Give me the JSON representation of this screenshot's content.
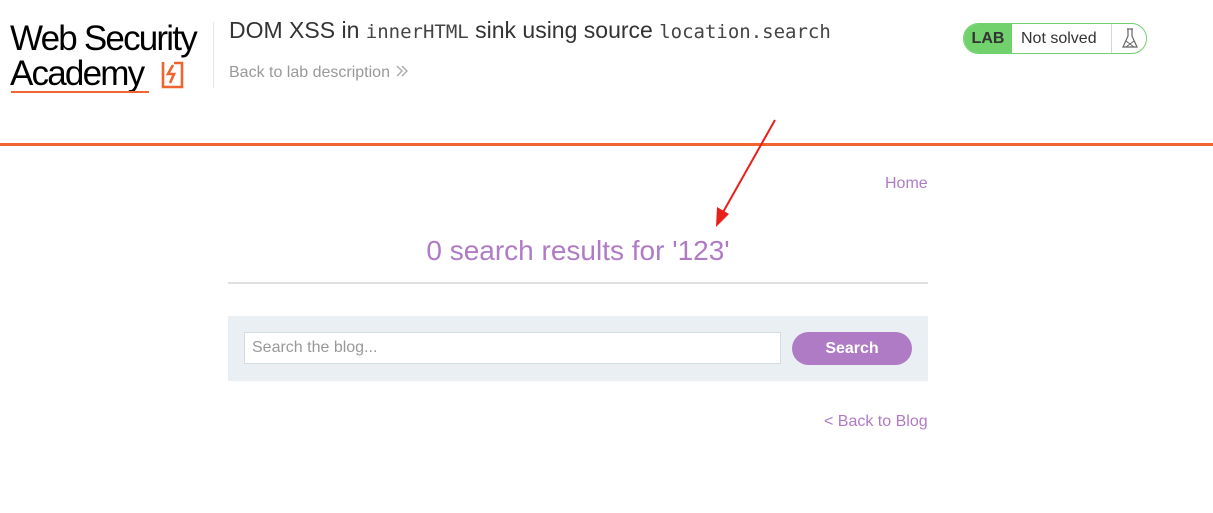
{
  "logo": {
    "line1": "Web Security",
    "line2": "Academy"
  },
  "header": {
    "title_prefix": "DOM XSS in ",
    "title_code1": "innerHTML",
    "title_middle": " sink using source ",
    "title_code2": "location.search",
    "back_link": "Back to lab description"
  },
  "status": {
    "lab_label": "LAB",
    "state": "Not solved"
  },
  "nav": {
    "home": "Home"
  },
  "results": {
    "heading": "0 search results for '123'"
  },
  "search": {
    "placeholder": "Search the blog...",
    "value": "",
    "button_label": "Search"
  },
  "footer": {
    "back_to_blog": "< Back to Blog"
  },
  "colors": {
    "brand_orange": "#f0652f",
    "accent_purple": "#b07bc5",
    "lab_green": "#70d16d",
    "panel_bg": "#e9eff2",
    "annotation_red": "#e8201b"
  },
  "icons": {
    "logo_mark": "lightning-bolt-icon",
    "back_chevron": "double-chevron-right-icon",
    "status_flask": "flask-icon"
  }
}
